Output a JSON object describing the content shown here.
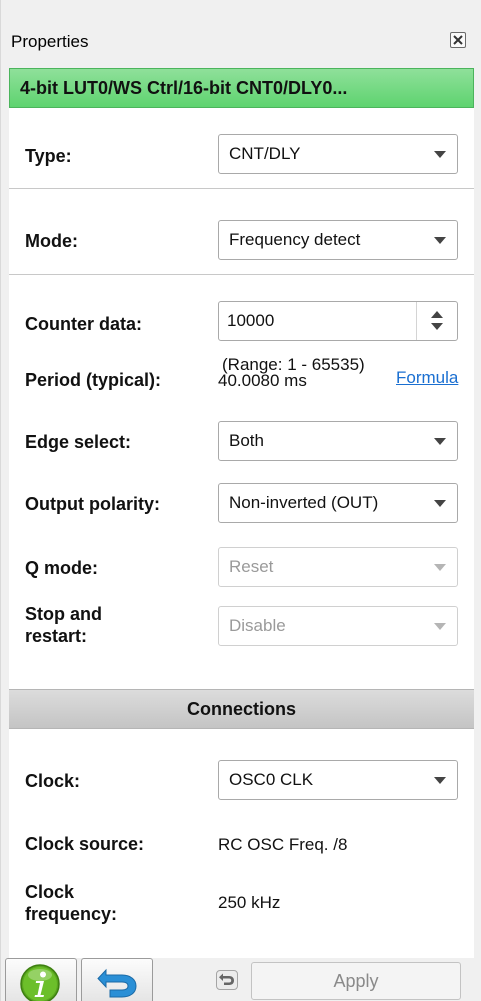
{
  "panel": {
    "title": "Properties",
    "block_title": "4-bit LUT0/WS Ctrl/16-bit CNT0/DLY0..."
  },
  "type": {
    "label": "Type:",
    "value": "CNT/DLY"
  },
  "mode": {
    "label": "Mode:",
    "value": "Frequency detect"
  },
  "counter": {
    "label": "Counter data:",
    "value": "10000",
    "range": "(Range:  1 - 65535)"
  },
  "period": {
    "label": "Period (typical):",
    "value": "40.0080 ms",
    "link": "Formula"
  },
  "edge": {
    "label": "Edge select:",
    "value": "Both"
  },
  "polarity": {
    "label": "Output polarity:",
    "value": "Non-inverted (OUT)"
  },
  "qmode": {
    "label": "Q mode:",
    "value": "Reset"
  },
  "stop": {
    "label_line1": "Stop and",
    "label_line2": "restart:",
    "value": "Disable"
  },
  "connections": {
    "header": "Connections",
    "clock_label": "Clock:",
    "clock_value": "OSC0 CLK",
    "source_label": "Clock source:",
    "source_value": "RC OSC Freq. /8",
    "freq_label_line1": "Clock",
    "freq_label_line2": "frequency:",
    "freq_value": "250 kHz"
  },
  "footer": {
    "apply_label": "Apply"
  },
  "colors": {
    "header_green": "#5ed36f",
    "link_blue": "#1a6fd1",
    "info_green": "#5aa51f",
    "undo_blue": "#2a8fd6"
  },
  "icons": {
    "close": "close-icon",
    "info": "info-icon",
    "undo": "undo-icon"
  }
}
